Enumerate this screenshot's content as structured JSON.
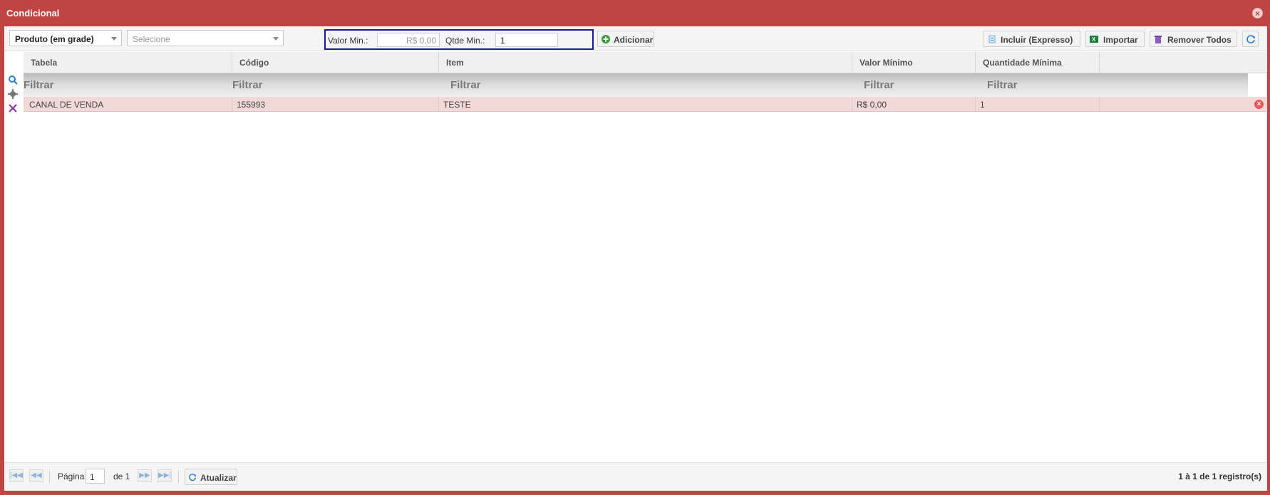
{
  "window": {
    "title": "Condicional"
  },
  "toolbar": {
    "type_select": {
      "value": "Produto (em grade)"
    },
    "item_select": {
      "placeholder": "Selecione"
    },
    "valor_min": {
      "label": "Valor Min.:",
      "value": "R$ 0,00"
    },
    "qtde_min": {
      "label": "Qtde Min.:",
      "value": "1"
    },
    "adicionar_label": "Adicionar",
    "incluir_label": "Incluir (Expresso)",
    "importar_label": "Importar",
    "remover_label": "Remover Todos"
  },
  "grid": {
    "columns": [
      "Tabela",
      "Código",
      "Item",
      "Valor Mínimo",
      "Quantidade Mínima"
    ],
    "filter_label": "Filtrar",
    "rows": [
      {
        "tabela": "CANAL DE VENDA",
        "codigo": "155993",
        "item": "TESTE",
        "valor_minimo": "R$ 0,00",
        "quantidade_minima": "1"
      }
    ]
  },
  "pager": {
    "page_label": "Página",
    "page_value": "1",
    "of_label": "de 1",
    "refresh_label": "Atualizar",
    "summary": "1 à 1 de 1 registro(s)"
  },
  "icons": [
    "close-icon",
    "add-icon",
    "incluir-icon",
    "excel-icon",
    "trash-icon",
    "refresh-icon",
    "search-icon",
    "gear-icon",
    "clear-filter-icon",
    "first-page-icon",
    "prev-page-icon",
    "next-page-icon",
    "last-page-icon",
    "delete-row-icon"
  ],
  "colors": {
    "title_bar": "#c04444",
    "selected_row": "#f3d8d8",
    "highlight_border": "#1a1aa0"
  }
}
